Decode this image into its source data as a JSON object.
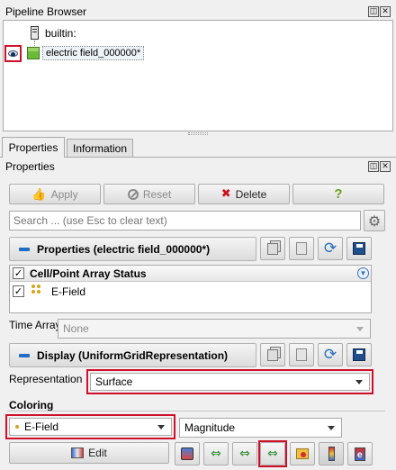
{
  "pipeline_browser": {
    "title": "Pipeline Browser",
    "items": [
      {
        "label": "builtin:"
      },
      {
        "label": "electric field_000000*"
      }
    ]
  },
  "tabs": [
    {
      "label": "Properties",
      "active": true
    },
    {
      "label": "Information",
      "active": false
    }
  ],
  "properties_panel": {
    "title": "Properties",
    "apply_label": "Apply",
    "reset_label": "Reset",
    "delete_label": "Delete",
    "help_label": "?",
    "search_placeholder": "Search ... (use Esc to clear text)",
    "properties_section": "Properties (electric field_000000*)",
    "array_status_header": "Cell/Point Array Status",
    "arrays": [
      {
        "label": "E-Field",
        "checked": true
      }
    ],
    "time_array_label": "Time Array",
    "time_array_value": "None",
    "display_section": "Display (UniformGridRepresentation)",
    "representation_label": "Representation",
    "representation_value": "Surface",
    "coloring_label": "Coloring",
    "coloring_array": "E-Field",
    "coloring_component": "Magnitude",
    "edit_label": "Edit"
  },
  "colors": {
    "highlight_red": "#d0102a",
    "section_accent": "#1e6ec8",
    "delete_red": "#cc1122"
  }
}
